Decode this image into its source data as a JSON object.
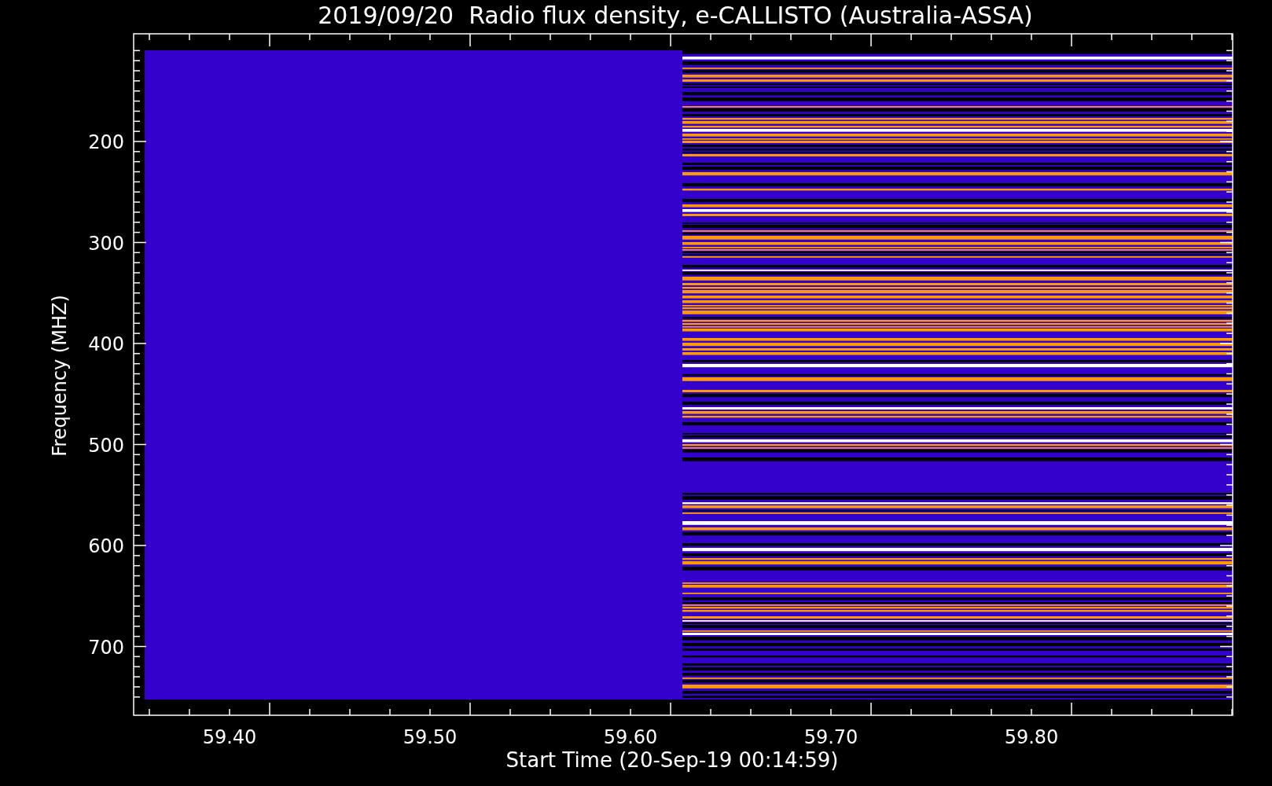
{
  "plot": {
    "title": "2019/09/20  Radio flux density, e-CALLISTO (Australia-ASSA)",
    "xlabel": "Start Time (20-Sep-19 00:14:59)",
    "ylabel": "Frequency (MHZ)",
    "xticks": [
      "59.40",
      "59.50",
      "59.60",
      "59.70",
      "59.80"
    ],
    "yticks": [
      "200",
      "300",
      "400",
      "500",
      "600",
      "700"
    ]
  }
}
